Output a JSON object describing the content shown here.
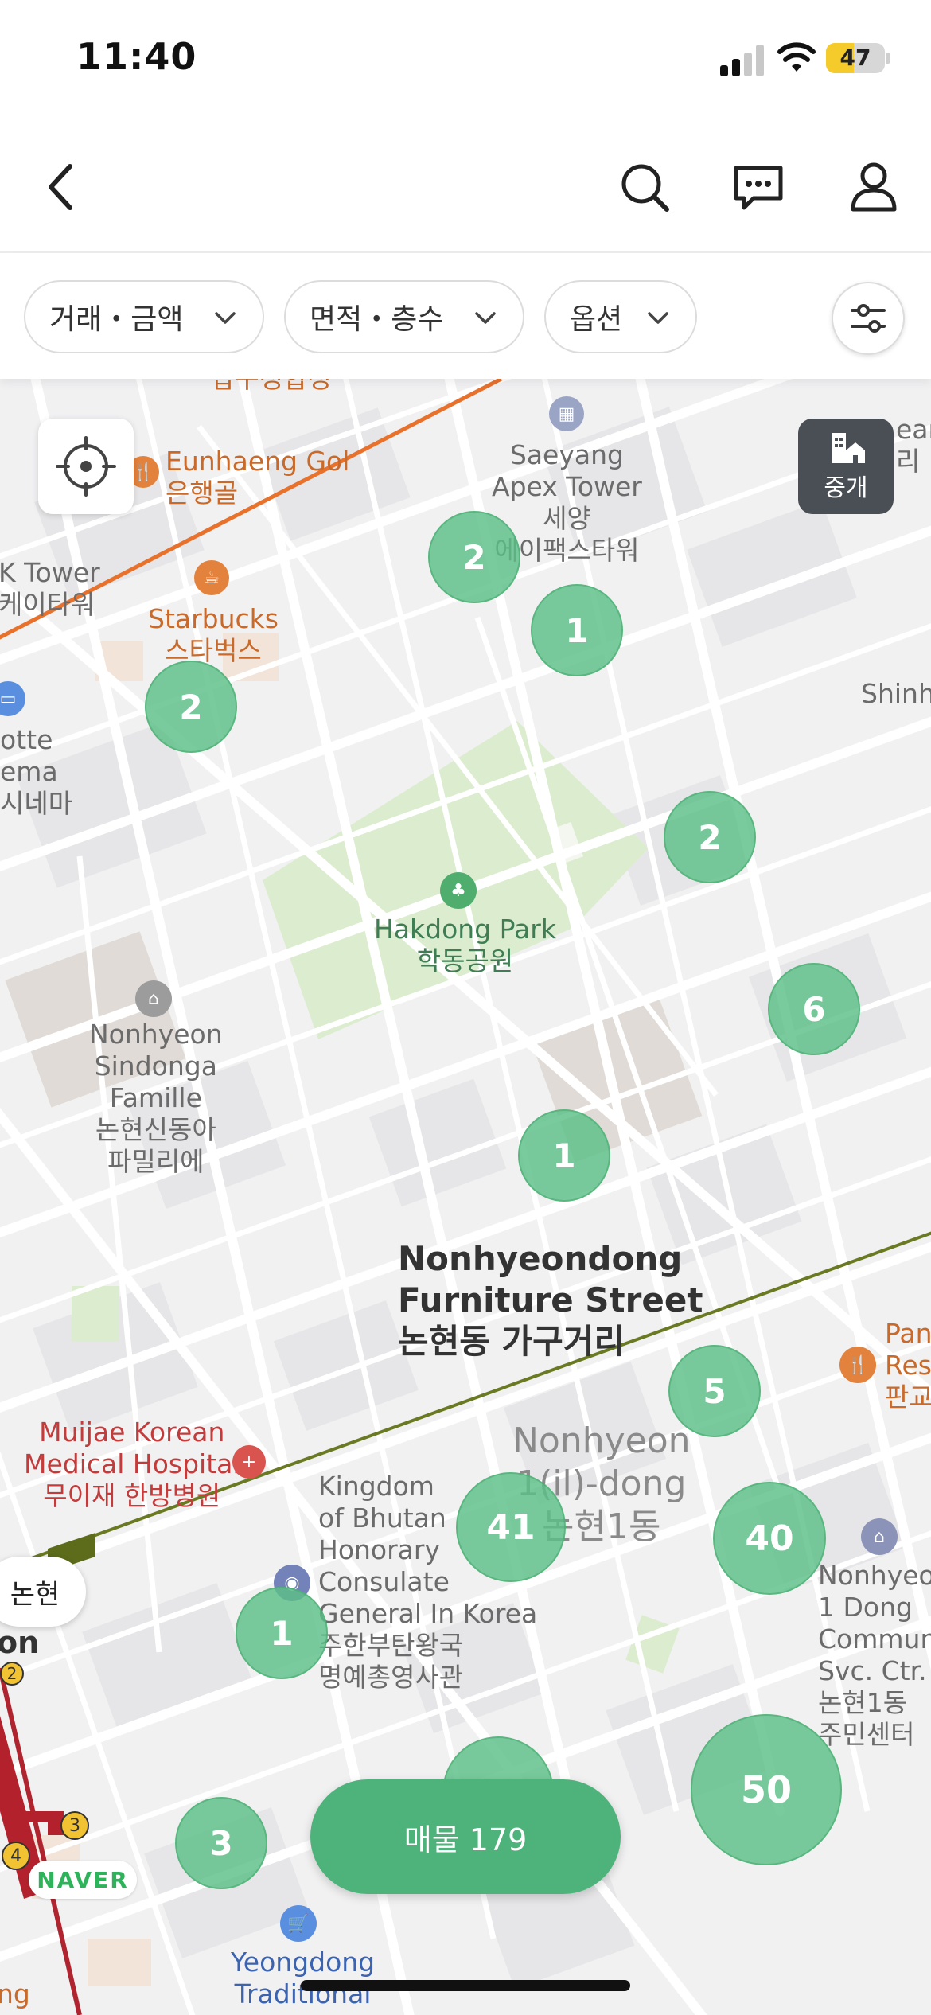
{
  "status": {
    "time": "11:40",
    "battery": "47",
    "battery_level": 0.47
  },
  "nav": {
    "back": "back-arrow-icon",
    "search": "search-icon",
    "chat": "chat-icon",
    "profile": "user-icon"
  },
  "filters": [
    {
      "label": "거래・금액"
    },
    {
      "label": "면적・층수"
    },
    {
      "label": "옵션"
    }
  ],
  "map": {
    "broker_label": "중개",
    "station_label": "논현",
    "naver": "NAVER",
    "labels": {
      "top_cut": "압구정합정",
      "eunhaeng_en": "Eunhaeng Gol",
      "eunhaeng_ko": "은행골",
      "saeyang_1": "Saeyang",
      "saeyang_2": "Apex Tower",
      "saeyang_3": "세양",
      "saeyang_4": "에이팩스타워",
      "ktower_en": "K Tower",
      "ktower_ko": "케이타워",
      "starbucks_en": "Starbucks",
      "starbucks_ko": "스타벅스",
      "cinema_1": "otte",
      "cinema_2": "ema",
      "cinema_3": "시네마",
      "shinh": "Shinh",
      "ean_1": "ean",
      "ean_2": "리",
      "park_en": "Hakdong Park",
      "park_ko": "학동공원",
      "famille_1": "Nonhyeon",
      "famille_2": "Sindonga",
      "famille_3": "Famille",
      "famille_4": "논현신동아",
      "famille_5": "파밀리에",
      "furniture_1": "Nonhyeondong",
      "furniture_2": "Furniture Street",
      "furniture_3": "논현동 가구거리",
      "pan_1": "Pan",
      "pan_2": "Res",
      "pan_3": "판교",
      "muijae_1": "Muijae Korean",
      "muijae_2": "Medical Hospital",
      "muijae_3": "무이재 한방병원",
      "dong_1": "Nonhyeon",
      "dong_2": "1(il)-dong",
      "dong_3": "논현1동",
      "bhutan_1": "Kingdom",
      "bhutan_2": "of Bhutan",
      "bhutan_3": "Honorary",
      "bhutan_4": "Consulate",
      "bhutan_5": "General In Korea",
      "bhutan_6": "주한부탄왕국",
      "bhutan_7": "명예총영사관",
      "comm_1": "Nonhyeon",
      "comm_2": "1 Dong",
      "comm_3": "Communit",
      "comm_4": "Svc. Ctr.",
      "comm_5": "논현1동",
      "comm_6": "주민센터",
      "on": "on",
      "yeongdong_1": "Yeongdong",
      "yeongdong_2": "Traditional",
      "ng": "ng",
      "line3": "3",
      "line4": "4",
      "line2": "2"
    },
    "clusters": [
      "2",
      "1",
      "2",
      "2",
      "6",
      "1",
      "5",
      "41",
      "40",
      "1",
      "3",
      "50"
    ]
  },
  "listing_button": "매물 179"
}
